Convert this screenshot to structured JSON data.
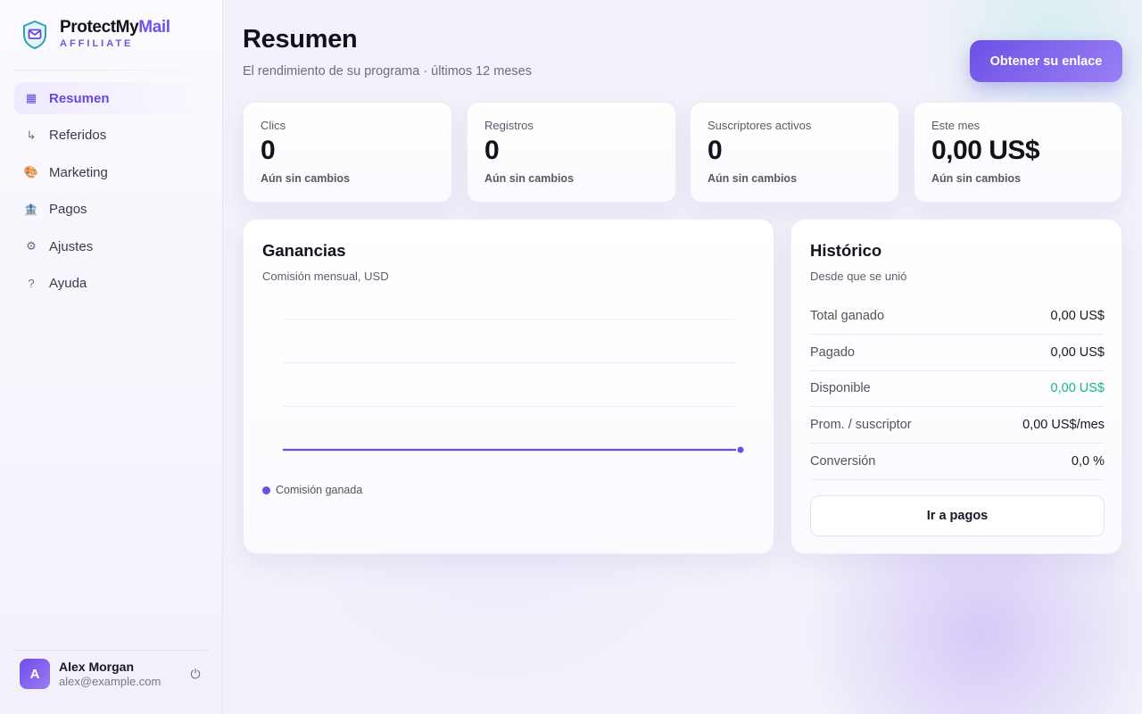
{
  "brand": {
    "name_main": "ProtectMy",
    "name_accent": "Mail",
    "subtitle": "AFFILIATE"
  },
  "nav": [
    {
      "label": "Resumen",
      "icon": "dashboard-icon",
      "glyph": "▦",
      "active": true
    },
    {
      "label": "Referidos",
      "icon": "referral-arrow-icon",
      "glyph": "↳",
      "active": false
    },
    {
      "label": "Marketing",
      "icon": "palette-icon",
      "glyph": "🎨",
      "active": false
    },
    {
      "label": "Pagos",
      "icon": "bank-icon",
      "glyph": "🏦",
      "active": false
    },
    {
      "label": "Ajustes",
      "icon": "gear-icon",
      "glyph": "⚙",
      "active": false
    },
    {
      "label": "Ayuda",
      "icon": "help-icon",
      "glyph": "?",
      "active": false
    }
  ],
  "user": {
    "initial": "A",
    "name": "Alex Morgan",
    "email": "alex@example.com",
    "logout_glyph": "⏻"
  },
  "header": {
    "title": "Resumen",
    "subtitle": "El rendimiento de su programa · últimos 12 meses",
    "cta_label": "Obtener su enlace"
  },
  "stats": [
    {
      "label": "Clics",
      "value": "0",
      "note": "Aún sin cambios"
    },
    {
      "label": "Registros",
      "value": "0",
      "note": "Aún sin cambios"
    },
    {
      "label": "Suscriptores activos",
      "value": "0",
      "note": "Aún sin cambios"
    },
    {
      "label": "Este mes",
      "value": "0,00 US$",
      "note": "Aún sin cambios"
    }
  ],
  "earnings": {
    "title": "Ganancias",
    "subtitle": "Comisión mensual, USD",
    "legend_label": "Comisión ganada"
  },
  "chart_data": {
    "type": "line",
    "title": "Ganancias",
    "subtitle": "Comisión mensual, USD",
    "series": [
      {
        "name": "Comisión ganada",
        "values": [
          0,
          0,
          0,
          0,
          0,
          0,
          0,
          0,
          0,
          0,
          0,
          0
        ],
        "color": "#6a4fe0"
      }
    ],
    "x_points": 12,
    "ylim": [
      0,
      1
    ],
    "grid": true,
    "gridlines": 4,
    "legend": "bottom-left"
  },
  "history": {
    "title": "Histórico",
    "subtitle": "Desde que se unió",
    "rows": [
      {
        "label": "Total ganado",
        "value": "0,00 US$",
        "highlight": false
      },
      {
        "label": "Pagado",
        "value": "0,00 US$",
        "highlight": false
      },
      {
        "label": "Disponible",
        "value": "0,00 US$",
        "highlight": true
      },
      {
        "label": "Prom. / suscriptor",
        "value": "0,00 US$/mes",
        "highlight": false
      },
      {
        "label": "Conversión",
        "value": "0,0 %",
        "highlight": false
      }
    ],
    "button_label": "Ir a pagos"
  },
  "colors": {
    "accent": "#6e4fe7",
    "positive": "#19b487"
  }
}
